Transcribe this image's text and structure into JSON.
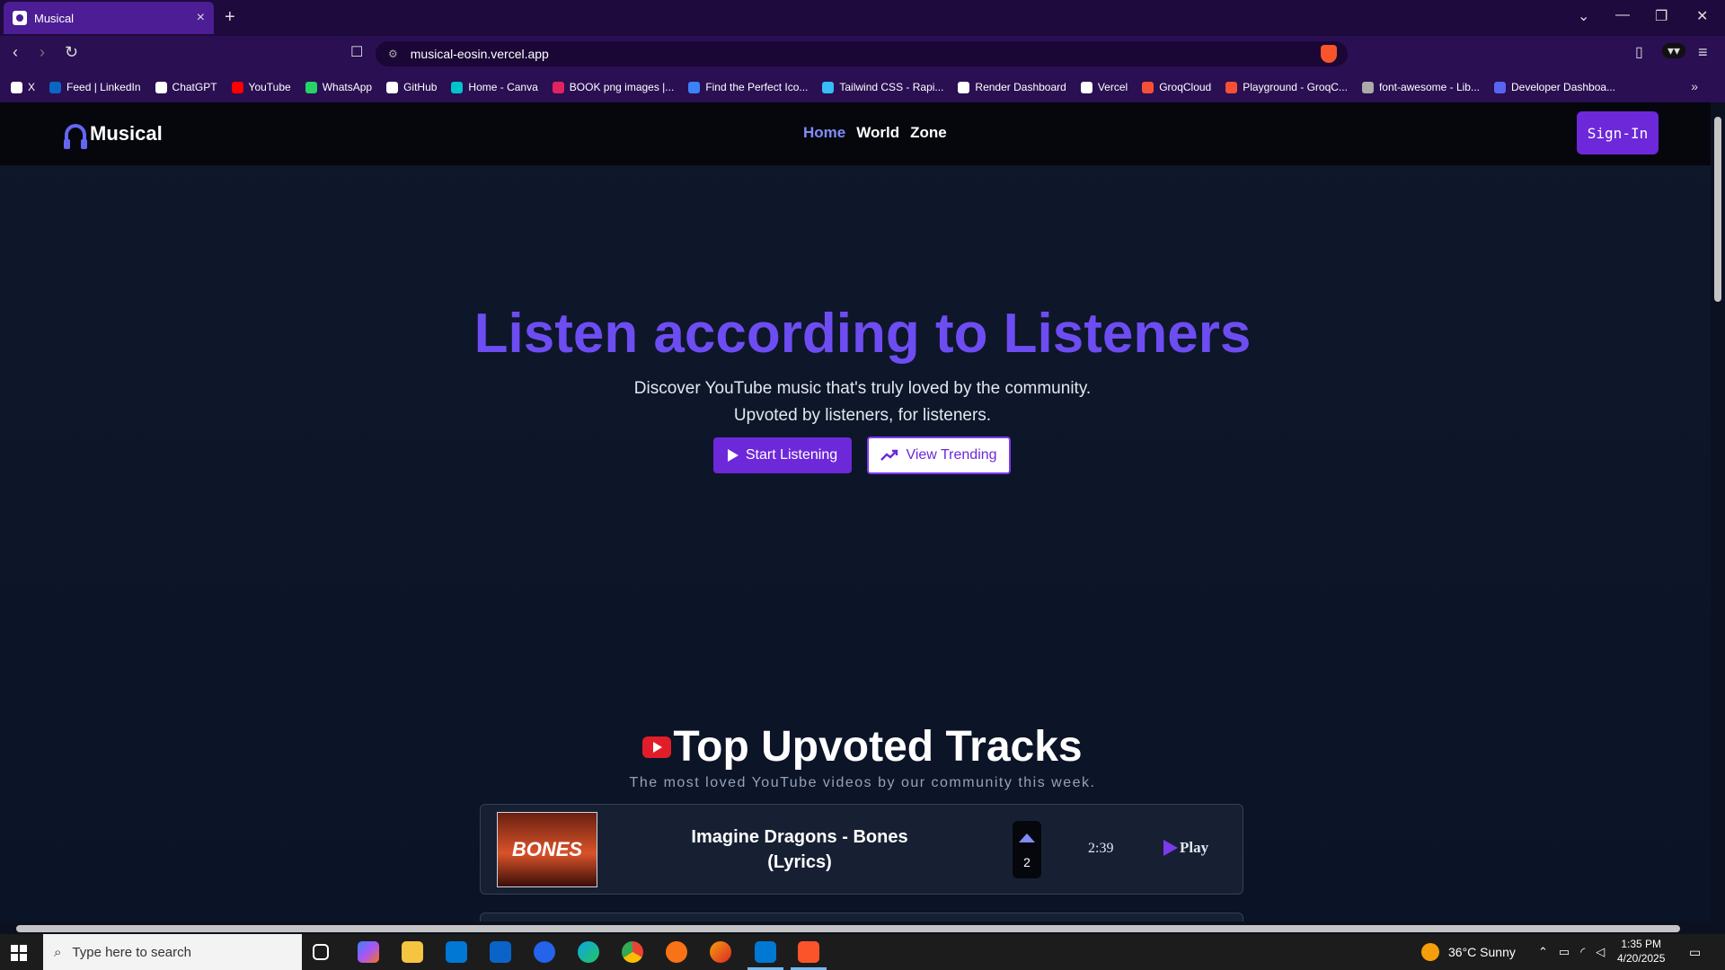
{
  "browser": {
    "tab_title": "Musical",
    "tab_close": "×",
    "new_tab": "+",
    "url": "musical-eosin.vercel.app",
    "bookmarks": [
      {
        "label": "X",
        "color": "#ffffff"
      },
      {
        "label": "Feed | LinkedIn",
        "color": "#0a66c2"
      },
      {
        "label": "ChatGPT",
        "color": "#ffffff"
      },
      {
        "label": "YouTube",
        "color": "#ff0000"
      },
      {
        "label": "WhatsApp",
        "color": "#25d366"
      },
      {
        "label": "GitHub",
        "color": "#ffffff"
      },
      {
        "label": "Home - Canva",
        "color": "#00c4cc"
      },
      {
        "label": "BOOK png images |...",
        "color": "#e0245e"
      },
      {
        "label": "Find the Perfect Ico...",
        "color": "#3b82f6"
      },
      {
        "label": "Tailwind CSS - Rapi...",
        "color": "#38bdf8"
      },
      {
        "label": "Render Dashboard",
        "color": "#ffffff"
      },
      {
        "label": "Vercel",
        "color": "#ffffff"
      },
      {
        "label": "GroqCloud",
        "color": "#f55036"
      },
      {
        "label": "Playground - GroqC...",
        "color": "#f55036"
      },
      {
        "label": "font-awesome - Lib...",
        "color": "#aaaaaa"
      },
      {
        "label": "Developer Dashboa...",
        "color": "#5865f2"
      }
    ],
    "more_bookmarks": "»"
  },
  "header": {
    "logo_text": "Musical",
    "nav": {
      "home": "Home",
      "world": "World",
      "zone": "Zone"
    },
    "signin_label": "Sign-In"
  },
  "hero": {
    "title": "Listen according to Listeners",
    "subtitle_line1": "Discover YouTube music that's truly loved by the community.",
    "subtitle_line2": "Upvoted by listeners, for listeners.",
    "start_label": "Start Listening",
    "trending_label": "View Trending"
  },
  "tracks_section": {
    "title": "Top Upvoted Tracks",
    "subtitle": "The most loved YouTube videos by our community this week.",
    "tracks": [
      {
        "thumbnail_text": "BONES",
        "title": "Imagine Dragons - Bones (Lyrics)",
        "votes": "2",
        "duration": "2:39",
        "play_label": "Play"
      }
    ]
  },
  "taskbar": {
    "search_placeholder": "Type here to search",
    "weather": "36°C  Sunny",
    "time": "1:35 PM",
    "date": "4/20/2025"
  }
}
